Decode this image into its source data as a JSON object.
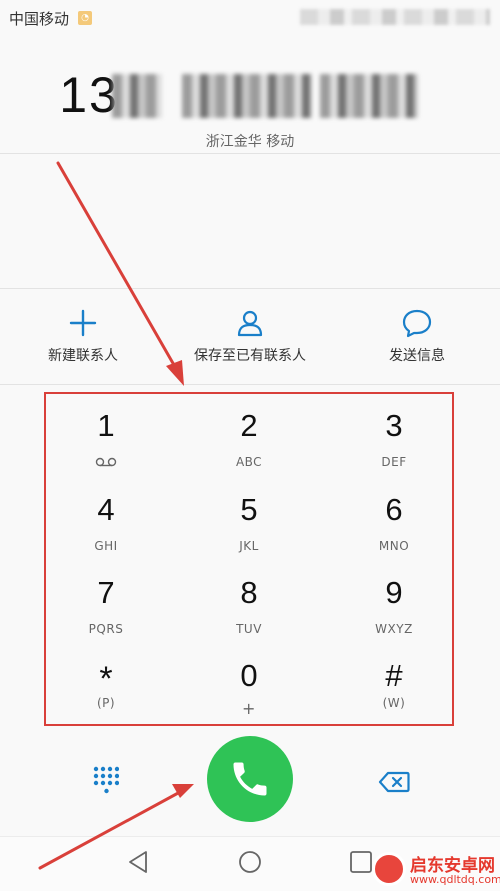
{
  "status_bar": {
    "carrier": "中国移动",
    "sim_icon": "sim-card-icon"
  },
  "dialer": {
    "number": "13",
    "location": "浙江金华 移动"
  },
  "actions": [
    {
      "label": "新建联系人",
      "icon": "plus-icon"
    },
    {
      "label": "保存至已有联系人",
      "icon": "person-icon"
    },
    {
      "label": "发送信息",
      "icon": "message-bubble-icon"
    }
  ],
  "keys": [
    {
      "digit": "1",
      "letters": ""
    },
    {
      "digit": "2",
      "letters": "ABC"
    },
    {
      "digit": "3",
      "letters": "DEF"
    },
    {
      "digit": "4",
      "letters": "GHI"
    },
    {
      "digit": "5",
      "letters": "JKL"
    },
    {
      "digit": "6",
      "letters": "MNO"
    },
    {
      "digit": "7",
      "letters": "PQRS"
    },
    {
      "digit": "8",
      "letters": "TUV"
    },
    {
      "digit": "9",
      "letters": "WXYZ"
    },
    {
      "digit": "*",
      "letters": "(P)"
    },
    {
      "digit": "0",
      "letters": "+"
    },
    {
      "digit": "#",
      "letters": "(W)"
    }
  ],
  "bottom": {
    "dialpad_icon": "dialpad-grid-icon",
    "call_icon": "phone-icon",
    "backspace_icon": "backspace-icon"
  },
  "nav": [
    "back-icon",
    "home-icon",
    "recents-icon"
  ],
  "watermark": {
    "title": "启东安卓网",
    "url": "www.qdltdq.com"
  },
  "colors": {
    "accent_blue": "#1a7fc9",
    "call_green": "#2fc356",
    "annotation_red": "#d9403a"
  }
}
